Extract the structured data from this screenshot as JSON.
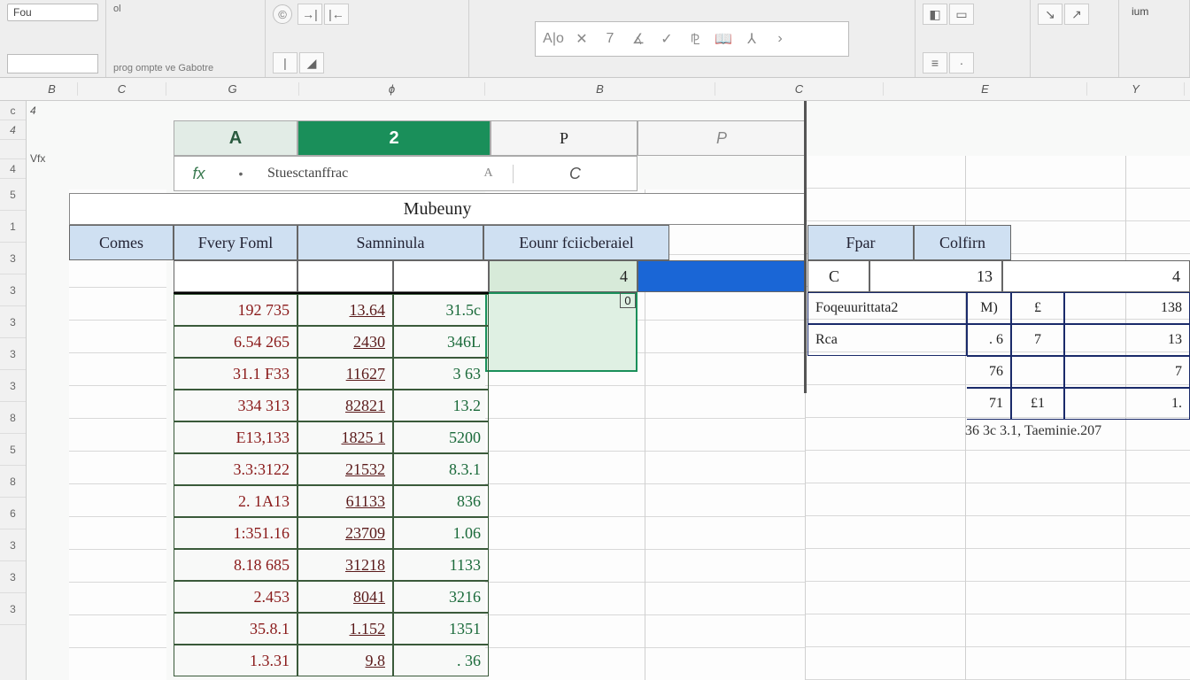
{
  "ribbon": {
    "tab_fou": "Fou",
    "txt_ol": "ol",
    "caption_prog": "prog ompte ve Gabotre",
    "btn_sum": "ium",
    "icons": [
      "A|o",
      "✕",
      "7",
      "∡",
      "✓",
      "⅊",
      "🕮",
      "⅄",
      "➚"
    ]
  },
  "colstrip": {
    "cols": [
      "B",
      "C",
      "G",
      "ϕ",
      "B",
      "C",
      "E",
      "Y"
    ]
  },
  "gutter": {
    "top1": "c",
    "top2": "4",
    "vfx": "Vfx",
    "l4": "4",
    "rows": [
      "5",
      "1",
      "3",
      "3",
      "3",
      "3",
      "3",
      "8",
      "5",
      "8",
      "6",
      "3",
      "3",
      "3"
    ]
  },
  "activeHeader": {
    "a": "A",
    "b": "2"
  },
  "fx": {
    "fx": "fx",
    "text": "Stuesctanffrac",
    "dotA": "A",
    "tailC": "C",
    "tailP": "P"
  },
  "titleRow": "Mubeuny",
  "blueHeaders": {
    "left": [
      "Comes",
      "Fvery Foml",
      "Samninula",
      "Eounr fciicberaiel"
    ],
    "right": [
      "Fpar",
      "Colfirn"
    ]
  },
  "firstDataRow": {
    "val4": "4",
    "val0": "0",
    "right_c": "C",
    "right_13": "13",
    "right_4": "4"
  },
  "table": [
    {
      "c1": "192 735",
      "c2": "13.64",
      "c3": "31.5c"
    },
    {
      "c1": "6.54 265",
      "c2": "2430",
      "c3": "346L"
    },
    {
      "c1": "31.1 F33",
      "c2": "11627",
      "c3": "3 63"
    },
    {
      "c1": "334 313",
      "c2": "82821",
      "c3": "13.2"
    },
    {
      "c1": "E13,133",
      "c2": "1825 1",
      "c3": "5200"
    },
    {
      "c1": "3.3:3122",
      "c2": "21532",
      "c3": "8.3.1"
    },
    {
      "c1": "2. 1A13",
      "c2": "61133",
      "c3": "836"
    },
    {
      "c1": "1:351.16",
      "c2": "23709",
      "c3": "1.06"
    },
    {
      "c1": "8.18 685",
      "c2": "31218",
      "c3": "1133"
    },
    {
      "c1": "2.453",
      "c2": "8041",
      "c3": "3216"
    },
    {
      "c1": "35.8.1",
      "c2": "1.152",
      "c3": "1351"
    },
    {
      "c1": "1.3.31",
      "c2": "9.8",
      "c3": ".  36"
    }
  ],
  "side": {
    "rows": [
      {
        "a": "Foqeuurittata2",
        "b": "M)",
        "c": "£",
        "d": "138"
      },
      {
        "a": "Rca",
        "b": ". 6",
        "c": "7",
        "d": "13"
      },
      {
        "a": "",
        "b": "76",
        "c": "",
        "d": "7"
      },
      {
        "a": "",
        "b": "71",
        "c": "£1",
        "d": "1."
      }
    ],
    "note": "36  3c  3.1, Taeminie.207"
  }
}
